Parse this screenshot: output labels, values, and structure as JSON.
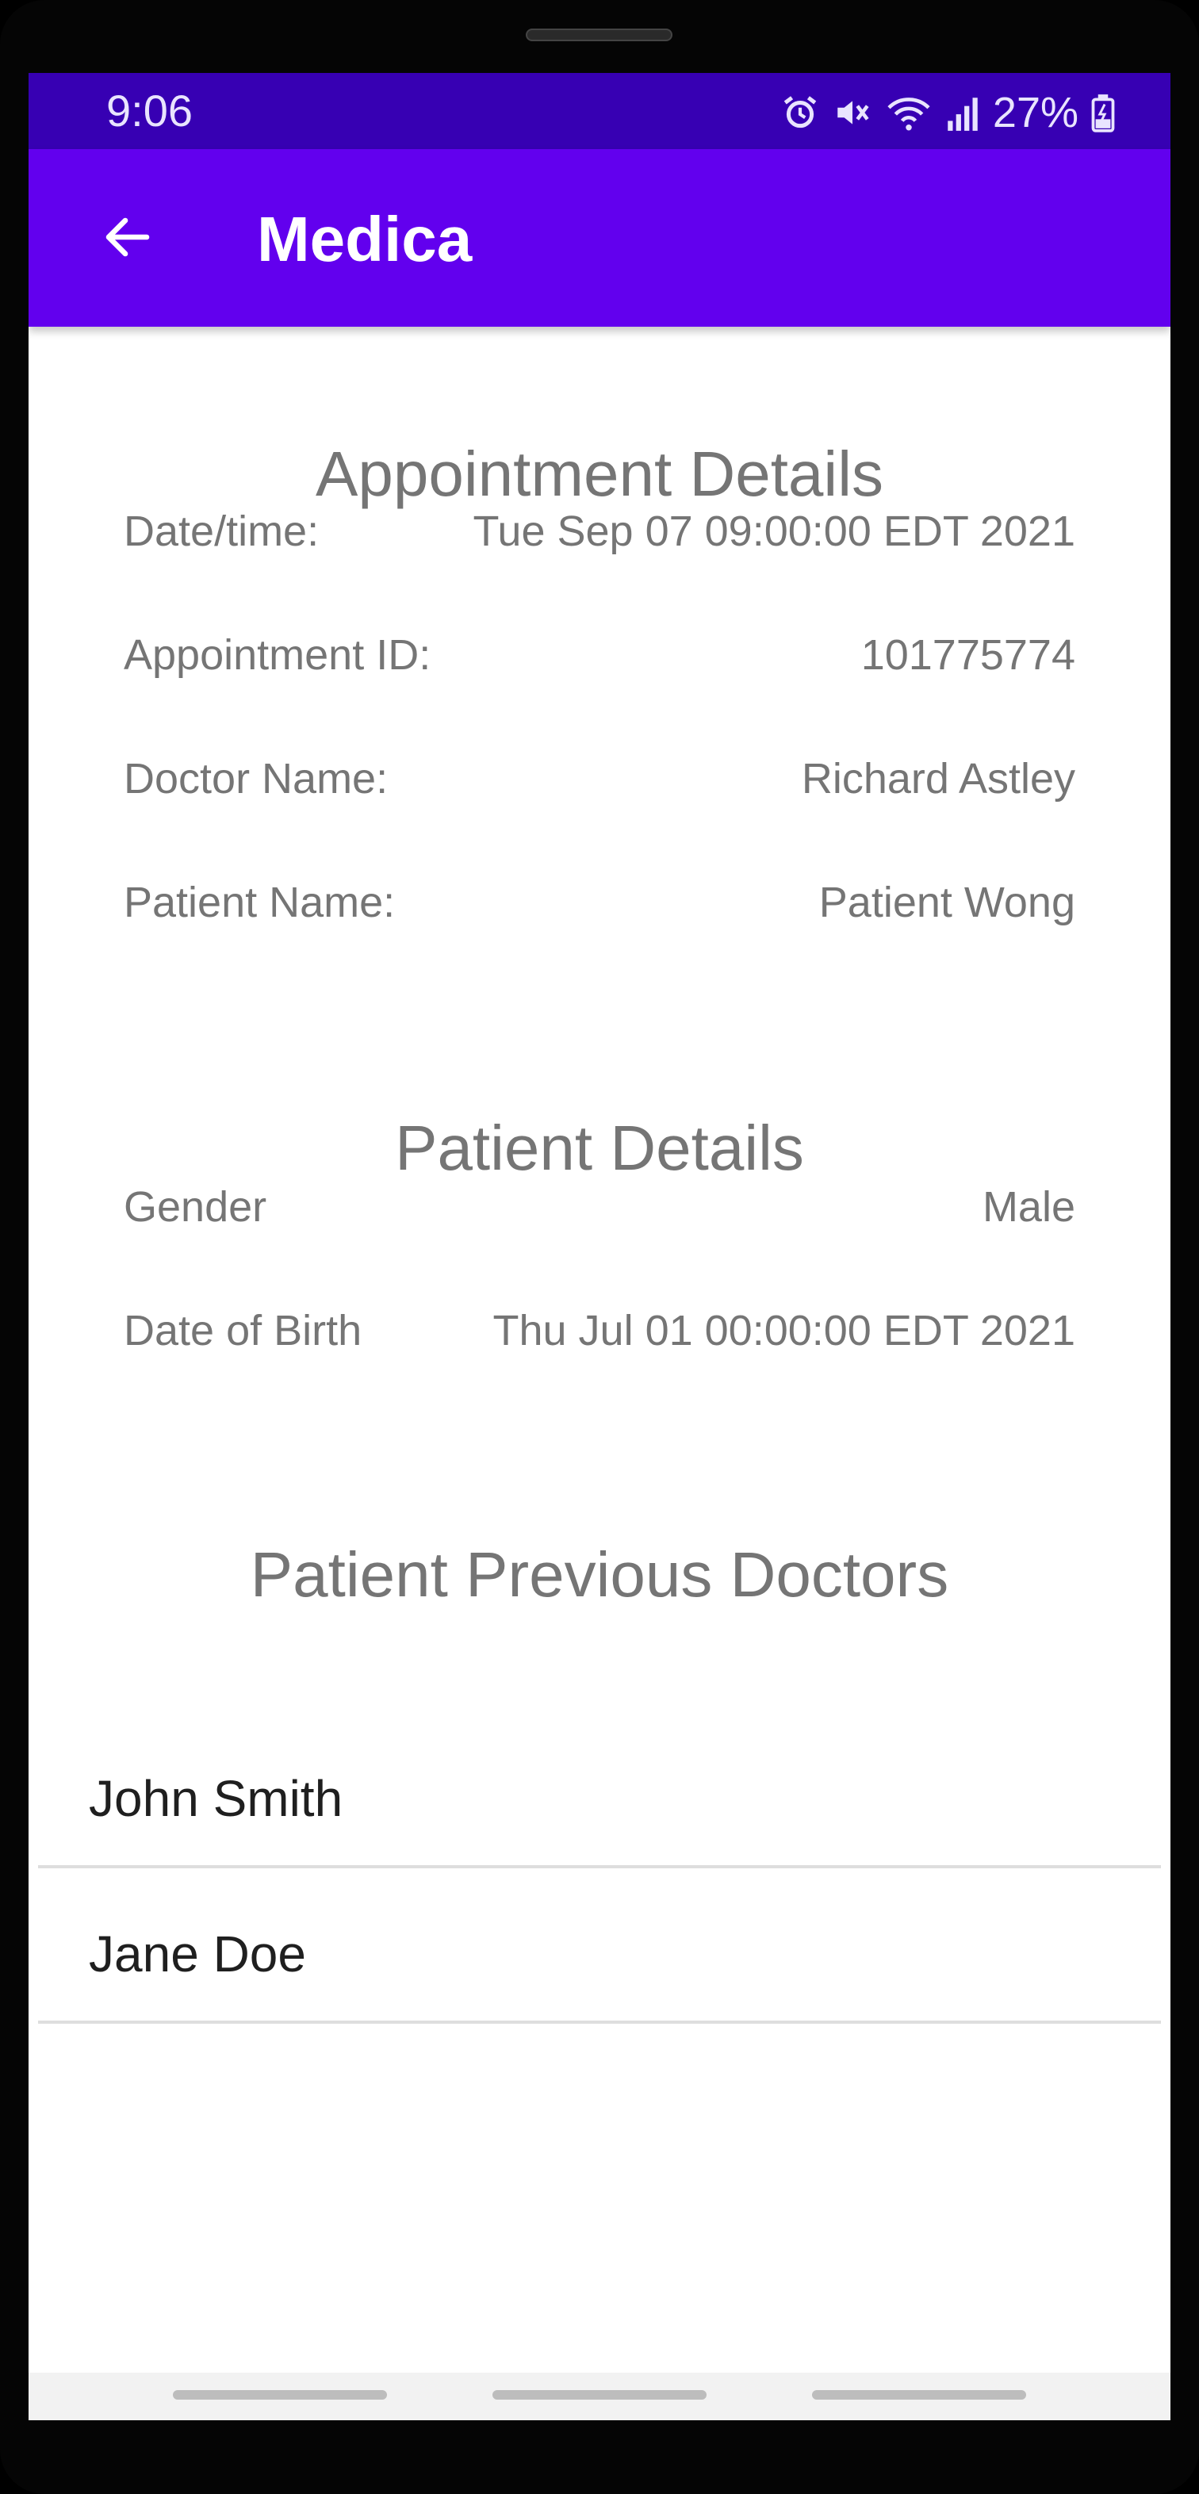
{
  "status_bar": {
    "time": "9:06",
    "battery": "27%",
    "icons": [
      "alarm-icon",
      "mute-icon",
      "wifi-icon",
      "signal-icon",
      "battery-icon"
    ]
  },
  "app_bar": {
    "back_icon": "arrow-left-icon",
    "title": "Medica",
    "color": "#6200ee",
    "status_color": "#3700b3"
  },
  "appointment": {
    "title": "Appointment Details",
    "rows": [
      {
        "label": "Date/time:",
        "value": "Tue Sep 07 09:00:00 EDT 2021"
      },
      {
        "label": "Appointment ID:",
        "value": "101775774"
      },
      {
        "label": "Doctor Name:",
        "value": "Richard Astley"
      },
      {
        "label": "Patient Name:",
        "value": "Patient Wong"
      }
    ]
  },
  "patient": {
    "title": "Patient Details",
    "rows": [
      {
        "label": "Gender",
        "value": "Male"
      },
      {
        "label": "Date of Birth",
        "value": "Thu Jul 01 00:00:00 EDT 2021"
      }
    ]
  },
  "previous_doctors": {
    "title": "Patient Previous Doctors",
    "items": [
      {
        "name": "John Smith"
      },
      {
        "name": "Jane Doe"
      }
    ]
  }
}
